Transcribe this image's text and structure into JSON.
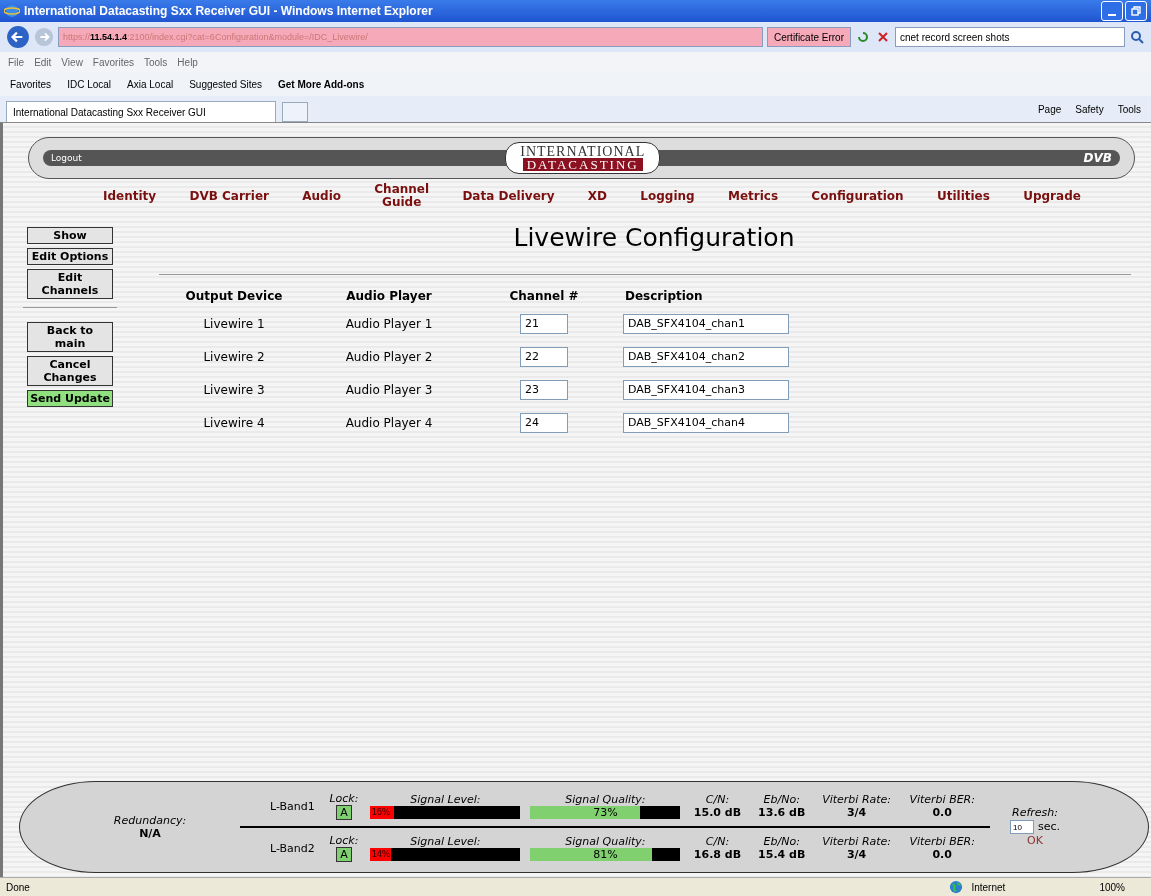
{
  "window": {
    "title": "International Datacasting Sxx Receiver GUI - Windows Internet Explorer"
  },
  "address": {
    "scheme": "https://",
    "host": "11.54.1.4",
    "rest": ":2100/index.cgi?cat=6Configuration&module=/IDC_Livewire/",
    "cert_error": "Certificate Error"
  },
  "search": {
    "value": "cnet record screen shots"
  },
  "menu": [
    "File",
    "Edit",
    "View",
    "Favorites",
    "Tools",
    "Help"
  ],
  "favorites_bar": {
    "label": "Favorites",
    "items": [
      {
        "label": "IDC Local",
        "kind": "folder"
      },
      {
        "label": "Axia Local",
        "kind": "folder"
      },
      {
        "label": "Suggested Sites",
        "kind": "ie"
      },
      {
        "label": "Get More Add-ons",
        "kind": "addons"
      }
    ]
  },
  "tab": {
    "title": "International Datacasting Sxx Receiver GUI"
  },
  "command_bar": [
    "Page",
    "Safety",
    "Tools"
  ],
  "header": {
    "logout": "Logout",
    "logo_top": "INTERNATIONAL",
    "logo_bottom": "DATACASTING",
    "badge": "DVB"
  },
  "nav": [
    {
      "label": "Identity"
    },
    {
      "label": "DVB Carrier"
    },
    {
      "label": "Audio"
    },
    {
      "label": "Channel\nGuide"
    },
    {
      "label": "Data Delivery"
    },
    {
      "label": "XD"
    },
    {
      "label": "Logging"
    },
    {
      "label": "Metrics"
    },
    {
      "label": "Configuration"
    },
    {
      "label": "Utilities"
    },
    {
      "label": "Upgrade"
    }
  ],
  "side_buttons": [
    {
      "label": "Show",
      "kind": "normal"
    },
    {
      "label": "Edit Options",
      "kind": "normal"
    },
    {
      "label": "Edit Channels",
      "kind": "normal"
    },
    {
      "kind": "divider"
    },
    {
      "label": "Back to main",
      "kind": "normal"
    },
    {
      "label": "Cancel Changes",
      "kind": "normal"
    },
    {
      "label": "Send Update",
      "kind": "submit"
    }
  ],
  "heading": "Livewire Configuration",
  "table": {
    "columns": [
      "Output Device",
      "Audio Player",
      "Channel #",
      "Description"
    ],
    "rows": [
      {
        "device": "Livewire 1",
        "player": "Audio Player 1",
        "channel": "21",
        "description": "DAB_SFX4104_chan1"
      },
      {
        "device": "Livewire 2",
        "player": "Audio Player 2",
        "channel": "22",
        "description": "DAB_SFX4104_chan2"
      },
      {
        "device": "Livewire 3",
        "player": "Audio Player 3",
        "channel": "23",
        "description": "DAB_SFX4104_chan3"
      },
      {
        "device": "Livewire 4",
        "player": "Audio Player 4",
        "channel": "24",
        "description": "DAB_SFX4104_chan4"
      }
    ]
  },
  "status_panel": {
    "redundancy_label": "Redundancy:",
    "redundancy_value": "N/A",
    "bands": [
      {
        "name": "L-Band1",
        "lock_label": "Lock:",
        "lock": "A",
        "signal_label": "Signal Level:",
        "signal": {
          "level": 0.16,
          "reading": "16%"
        },
        "quality_label": "Signal Quality:",
        "quality": {
          "level": 0.73,
          "reading": "73%"
        },
        "cn_label": "C/N:",
        "cn": "15.0 dB",
        "ebno_label": "Eb/No:",
        "ebno": "13.6 dB",
        "rate_label": "Viterbi Rate:",
        "rate": "3/4",
        "ber_label": "Viterbi BER:",
        "ber": "0.0"
      },
      {
        "name": "L-Band2",
        "lock_label": "Lock:",
        "lock": "A",
        "signal_label": "Signal Level:",
        "signal": {
          "level": 0.14,
          "reading": "14%"
        },
        "quality_label": "Signal Quality:",
        "quality": {
          "level": 0.81,
          "reading": "81%"
        },
        "cn_label": "C/N:",
        "cn": "16.8 dB",
        "ebno_label": "Eb/No:",
        "ebno": "15.4 dB",
        "rate_label": "Viterbi Rate:",
        "rate": "3/4",
        "ber_label": "Viterbi BER:",
        "ber": "0.0"
      }
    ],
    "refresh_label": "Refresh:",
    "refresh_value": "10",
    "refresh_unit": "sec.",
    "ok": "OK"
  },
  "status_bar": {
    "text": "Done",
    "zone": "Internet",
    "zoom": "100%"
  }
}
